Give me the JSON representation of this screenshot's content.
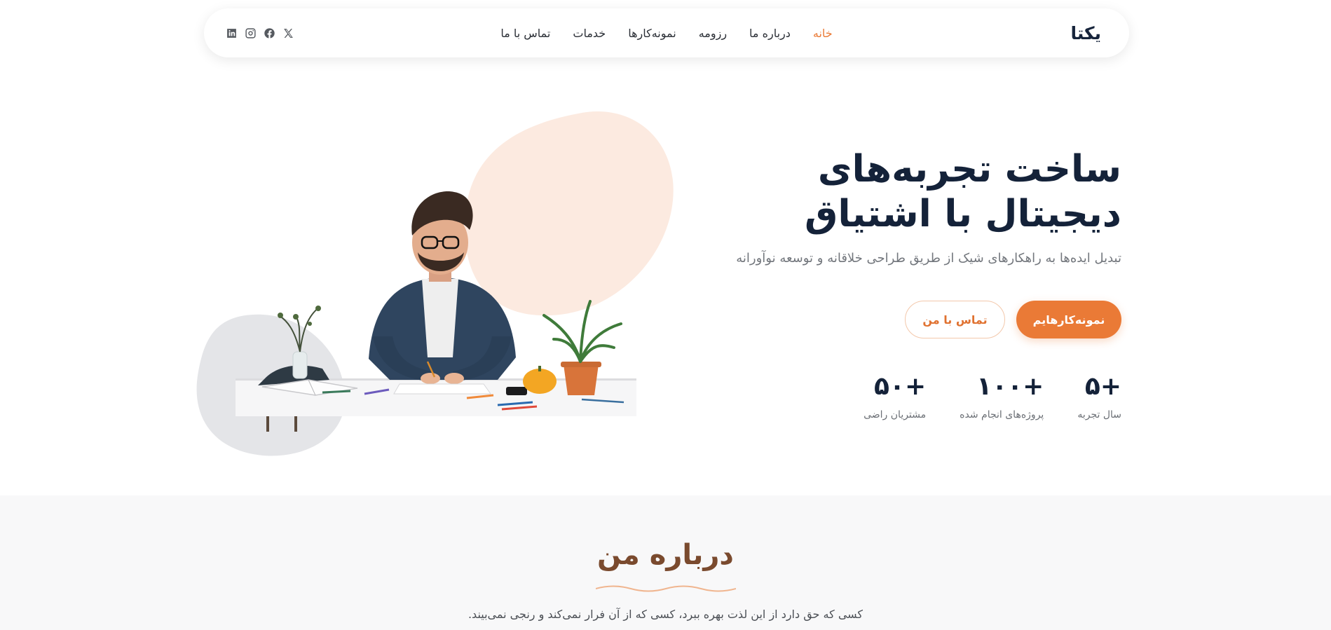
{
  "nav": {
    "brand": "یکتا",
    "links": [
      "خانه",
      "درباره ما",
      "رزومه",
      "نمونه‌کارها",
      "خدمات",
      "تماس با ما"
    ],
    "active": "خانه",
    "socials": [
      "x-icon",
      "facebook-icon",
      "instagram-icon",
      "linkedin-icon"
    ]
  },
  "hero": {
    "title": "ساخت تجربه‌های دیجیتال با اشتیاق",
    "subtitle": "تبدیل ایده‌ها به راهکارهای شیک از طریق طراحی خلاقانه و توسعه نوآورانه",
    "primary_button": "نمونه‌کارهایم",
    "secondary_button": "تماس با من",
    "stats": [
      {
        "value": "+۵",
        "label": "سال تجربه"
      },
      {
        "value": "+۱۰۰",
        "label": "پروژه‌های انجام شده"
      },
      {
        "value": "+۵۰",
        "label": "مشتریان راضی"
      }
    ]
  },
  "about": {
    "title": "درباره من",
    "text": "کسی که حق دارد از این لذت بهره ببرد، کسی که از آن فرار نمی‌کند و رنجی نمی‌بیند."
  },
  "colors": {
    "accent": "#ea7a36",
    "heading": "#142239",
    "blob_peach": "#fceae0",
    "blob_gray": "#e4e5e8",
    "about_bg": "#f8f8f9"
  }
}
